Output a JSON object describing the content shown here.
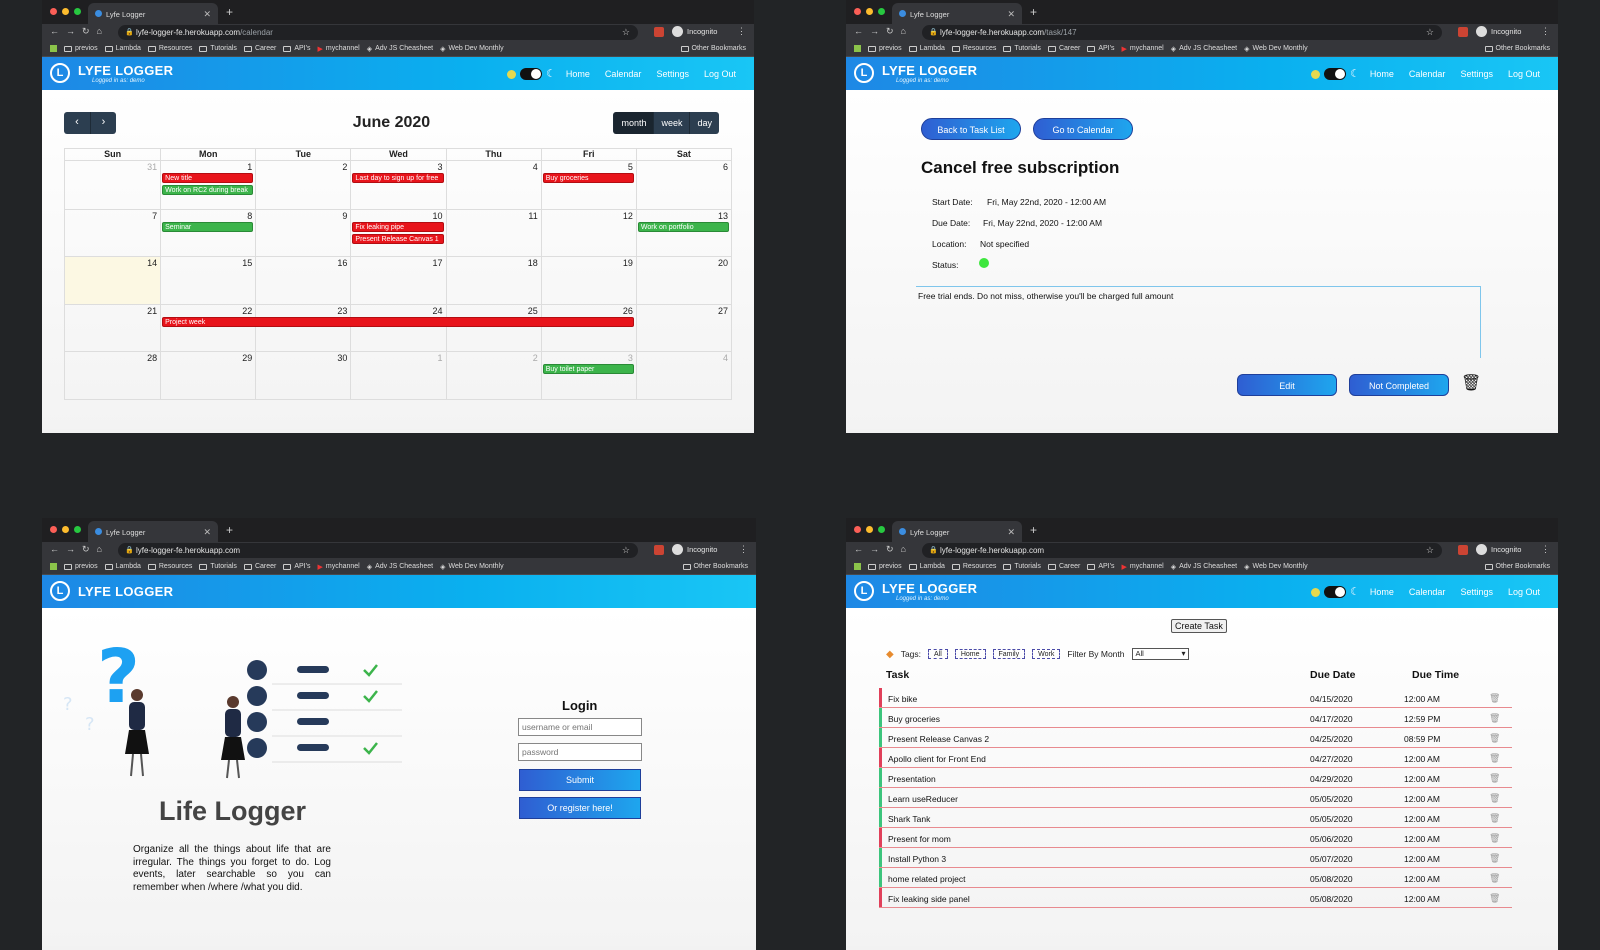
{
  "browser": {
    "tab_title": "Lyfe Logger",
    "incognito_label": "Incognito",
    "other_bookmarks": "Other Bookmarks",
    "bookmarks": [
      "previos",
      "Lambda",
      "Resources",
      "Tutorials",
      "Career",
      "API's",
      "mychannel",
      "Adv JS Cheasheet",
      "Web Dev Monthly"
    ]
  },
  "app": {
    "brand": "LYFE LOGGER",
    "logo_letter": "L",
    "logged_in": "Logged in as: demo",
    "nav": [
      "Home",
      "Calendar",
      "Settings",
      "Log Out"
    ]
  },
  "calendar_window": {
    "url_host": "lyfe-logger-fe.herokuapp.com",
    "url_path": "/calendar",
    "title": "June 2020",
    "prev": "‹",
    "next": "›",
    "views": [
      "month",
      "week",
      "day"
    ],
    "weekdays": [
      "Sun",
      "Mon",
      "Tue",
      "Wed",
      "Thu",
      "Fri",
      "Sat"
    ],
    "weeks": [
      [
        "31",
        "1",
        "2",
        "3",
        "4",
        "5",
        "6"
      ],
      [
        "7",
        "8",
        "9",
        "10",
        "11",
        "12",
        "13"
      ],
      [
        "14",
        "15",
        "16",
        "17",
        "18",
        "19",
        "20"
      ],
      [
        "21",
        "22",
        "23",
        "24",
        "25",
        "26",
        "27"
      ],
      [
        "28",
        "29",
        "30",
        "1",
        "2",
        "3",
        "4"
      ]
    ],
    "events": [
      "New title",
      "Work on RC2 during break",
      "Last day to sign up for free",
      "Buy groceries",
      "Seminar",
      "Fix leaking pipe",
      "Present Release Canvas 1",
      "Work on portfolio",
      "Project week",
      "Buy toilet paper"
    ]
  },
  "task_window": {
    "url_host": "lyfe-logger-fe.herokuapp.com",
    "url_path": "/task/147",
    "back_button": "Back to Task List",
    "calendar_button": "Go to Calendar",
    "title": "Cancel free subscription",
    "start_label": "Start Date:",
    "start_value": "Fri, May 22nd, 2020 - 12:00 AM",
    "due_label": "Due Date:",
    "due_value": "Fri, May 22nd, 2020 - 12:00 AM",
    "location_label": "Location:",
    "location_value": "Not specified",
    "status_label": "Status:",
    "status_color": "#3ee63e",
    "description": "Free trial ends. Do not miss, otherwise you'll be charged full amount",
    "edit_button": "Edit",
    "not_completed_button": "Not Completed"
  },
  "login_window": {
    "url_host": "lyfe-logger-fe.herokuapp.com",
    "heading": "Login",
    "username_placeholder": "username or email",
    "password_placeholder": "password",
    "submit": "Submit",
    "register": "Or register here!",
    "big_title": "Life Logger",
    "intro": "Organize all the things about life that are irregular. The things you forget to do. Log events, later searchable so you can remember when /where /what you did."
  },
  "tasklist_window": {
    "url_host": "lyfe-logger-fe.herokuapp.com",
    "create_button": "Create Task",
    "tags_label": "Tags:",
    "tags": [
      "All",
      "Home",
      "Family",
      "Work"
    ],
    "filter_label": "Filter By Month",
    "filter_value": "All",
    "col_task": "Task",
    "col_date": "Due Date",
    "col_time": "Due Time",
    "rows": [
      {
        "task": "Fix bike",
        "date": "04/15/2020",
        "time": "12:00 AM",
        "color": "#e0405a"
      },
      {
        "task": "Buy groceries",
        "date": "04/17/2020",
        "time": "12:59 PM",
        "color": "#3cc47c"
      },
      {
        "task": "Present Release Canvas 2",
        "date": "04/25/2020",
        "time": "08:59 PM",
        "color": "#3cc47c"
      },
      {
        "task": "Apollo client for Front End",
        "date": "04/27/2020",
        "time": "12:00 AM",
        "color": "#e0405a"
      },
      {
        "task": "Presentation",
        "date": "04/29/2020",
        "time": "12:00 AM",
        "color": "#3cc47c"
      },
      {
        "task": "Learn useReducer",
        "date": "05/05/2020",
        "time": "12:00 AM",
        "color": "#3cc47c"
      },
      {
        "task": "Shark Tank",
        "date": "05/05/2020",
        "time": "12:00 AM",
        "color": "#3cc47c"
      },
      {
        "task": "Present for mom",
        "date": "05/06/2020",
        "time": "12:00 AM",
        "color": "#e0405a"
      },
      {
        "task": "Install Python 3",
        "date": "05/07/2020",
        "time": "12:00 AM",
        "color": "#3cc47c"
      },
      {
        "task": "home related project",
        "date": "05/08/2020",
        "time": "12:00 AM",
        "color": "#3cc47c"
      },
      {
        "task": "Fix leaking side panel",
        "date": "05/08/2020",
        "time": "12:00 AM",
        "color": "#e0405a"
      }
    ]
  }
}
